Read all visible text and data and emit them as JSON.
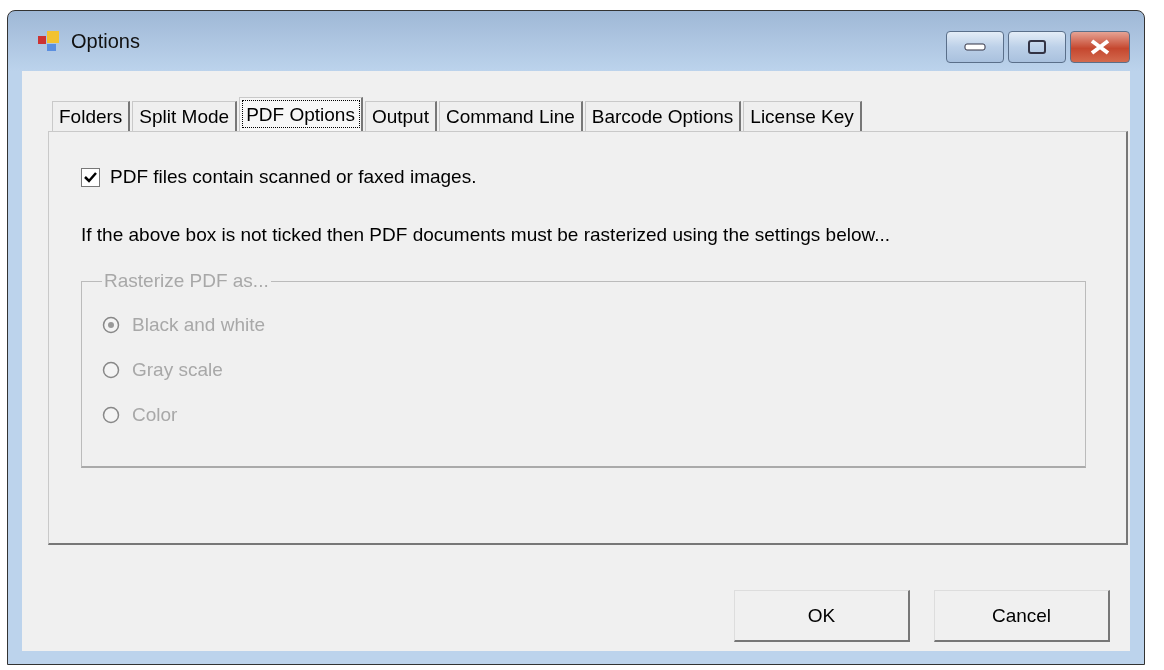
{
  "window": {
    "title": "Options"
  },
  "tabs": [
    {
      "label": "Folders",
      "selected": false
    },
    {
      "label": "Split Mode",
      "selected": false
    },
    {
      "label": "PDF Options",
      "selected": true
    },
    {
      "label": "Output",
      "selected": false
    },
    {
      "label": "Command Line",
      "selected": false
    },
    {
      "label": "Barcode Options",
      "selected": false
    },
    {
      "label": "License Key",
      "selected": false
    }
  ],
  "scanned_checkbox": {
    "label": "PDF files contain scanned or faxed images.",
    "checked": true
  },
  "note": "If the above box is not ticked then PDF documents must be rasterized using the settings below...",
  "rasterize_group": {
    "title": "Rasterize PDF as...",
    "disabled": true,
    "options": [
      {
        "label": "Black and white",
        "selected": true
      },
      {
        "label": "Gray scale",
        "selected": false
      },
      {
        "label": "Color",
        "selected": false
      }
    ]
  },
  "buttons": [
    "OK",
    "Cancel"
  ]
}
